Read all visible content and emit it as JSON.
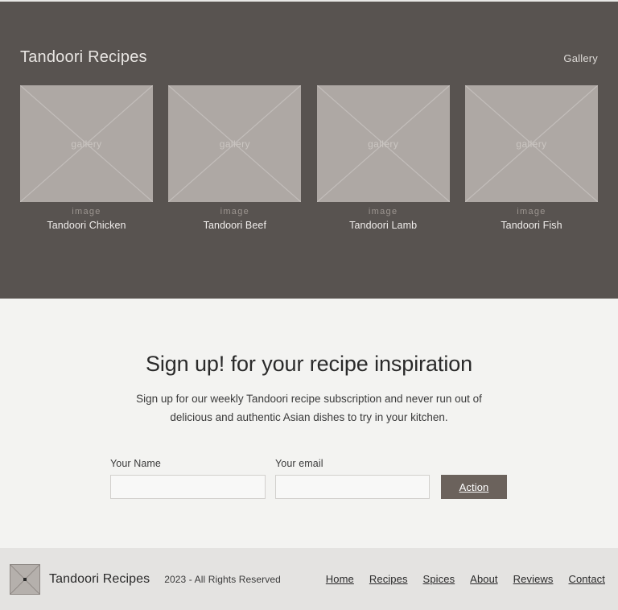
{
  "theme": {
    "hero_bg": "#585350",
    "placeholder_bg": "#aea8a4",
    "page_bg": "#f3f3f1",
    "footer_bg": "#e4e3e1",
    "button_bg": "#6b625c"
  },
  "hero": {
    "title": "Tandoori Recipes",
    "nav_label": "Gallery",
    "cards": [
      {
        "placeholder_text": "gallery",
        "kind": "image",
        "name": "Tandoori Chicken"
      },
      {
        "placeholder_text": "gallery",
        "kind": "image",
        "name": "Tandoori Beef"
      },
      {
        "placeholder_text": "gallery",
        "kind": "image",
        "name": "Tandoori Lamb"
      },
      {
        "placeholder_text": "gallery",
        "kind": "image",
        "name": "Tandoori Fish"
      }
    ]
  },
  "signup": {
    "heading": "Sign up! for your recipe inspiration",
    "description": "Sign up for our weekly Tandoori recipe subscription and never run out of delicious and authentic Asian dishes to try in your kitchen.",
    "fields": {
      "name": {
        "label": "Your Name",
        "value": "",
        "placeholder": ""
      },
      "email": {
        "label": "Your email",
        "value": "",
        "placeholder": ""
      }
    },
    "submit_label": "Action"
  },
  "footer": {
    "brand": "Tandoori Recipes",
    "copyright": "2023 - All Rights Reserved",
    "links": [
      {
        "label": "Home"
      },
      {
        "label": "Recipes"
      },
      {
        "label": "Spices"
      },
      {
        "label": "About"
      },
      {
        "label": "Reviews"
      },
      {
        "label": "Contact"
      }
    ]
  }
}
